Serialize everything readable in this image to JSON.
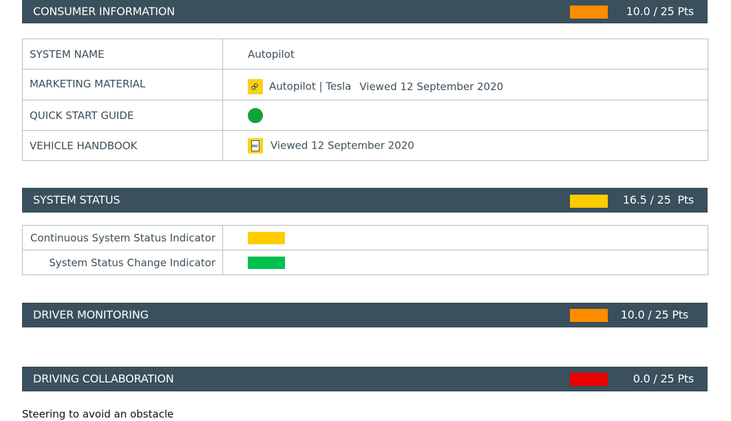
{
  "colors": {
    "orange": "#ff8c00",
    "yellow": "#ffcc00",
    "green": "#00c050",
    "red": "#ee0000",
    "dot_green": "#12a23a",
    "bar_bg": "#3a505c"
  },
  "consumer_info": {
    "title": "CONSUMER INFORMATION",
    "score": "10.0 / 25 Pts",
    "score_color": "#ff8c00",
    "rows": [
      {
        "label": "SYSTEM NAME",
        "value": "Autopilot"
      },
      {
        "label": "MARKETING MATERIAL",
        "icon": "link-icon",
        "link": "Autopilot | Tesla",
        "viewed": "Viewed 12 September 2020"
      },
      {
        "label": "QUICK START GUIDE",
        "icon": "green-dot-icon"
      },
      {
        "label": "VEHICLE HANDBOOK",
        "icon": "pdf-icon",
        "pdf_text": "PDF",
        "viewed": "Viewed 12 September 2020"
      }
    ]
  },
  "system_status": {
    "title": "SYSTEM STATUS",
    "score": "16.5 / 25  Pts",
    "score_color": "#ffcc00",
    "rows": [
      {
        "label": "Continuous System Status Indicator",
        "indicator_color": "#ffcc00"
      },
      {
        "label": "System Status Change Indicator",
        "indicator_color": "#00c050"
      }
    ]
  },
  "driver_monitoring": {
    "title": "DRIVER MONITORING",
    "score": "10.0 / 25 Pts",
    "score_color": "#ff8c00"
  },
  "driving_collaboration": {
    "title": "DRIVING COLLABORATION",
    "score": "0.0 / 25 Pts",
    "score_color": "#ee0000",
    "subheading": "Steering to avoid an obstacle"
  }
}
